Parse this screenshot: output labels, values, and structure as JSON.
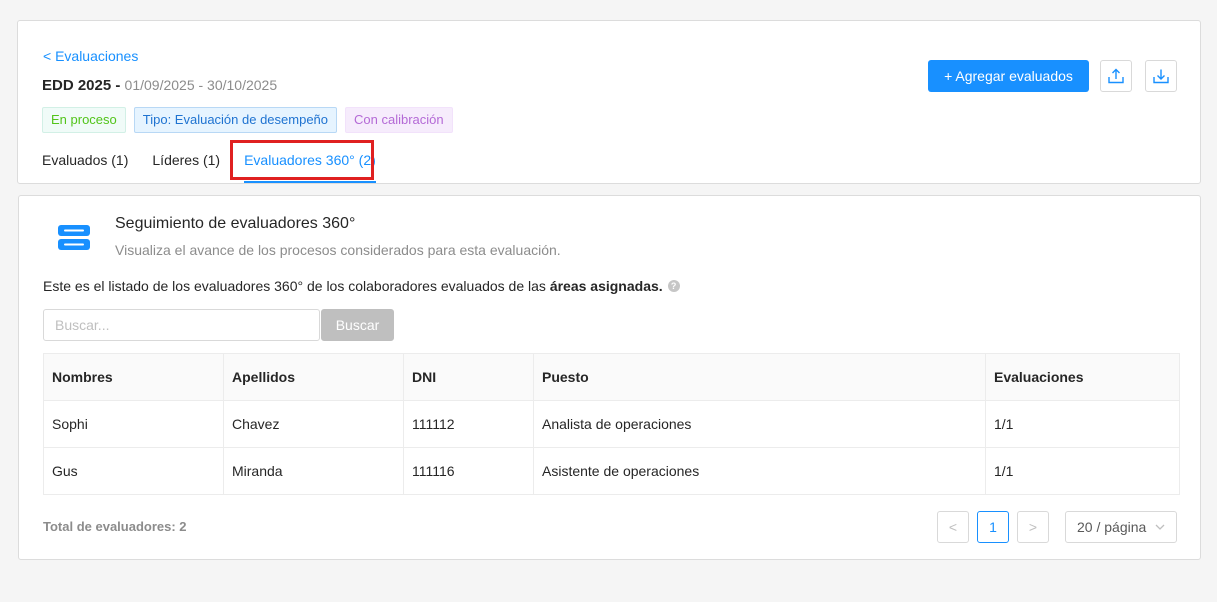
{
  "header": {
    "back_link": "< Evaluaciones",
    "title": "EDD 2025 -",
    "dates": "01/09/2025 - 30/10/2025",
    "tags": [
      "En proceso",
      "Tipo: Evaluación de desempeño",
      "Con calibración"
    ],
    "add_button": "+ Agregar evaluados",
    "upload_icon": "upload-icon",
    "download_icon": "download-icon",
    "tabs": [
      {
        "label": "Evaluados (1)"
      },
      {
        "label": "Líderes (1)"
      },
      {
        "label": "Evaluadores 360° (2)"
      }
    ]
  },
  "section": {
    "title": "Seguimiento de evaluadores 360°",
    "subtitle": "Visualiza el avance de los procesos considerados para esta evaluación.",
    "desc_prefix": "Este es el listado de los evaluadores 360° de los colaboradores evaluados de las",
    "desc_bold": "áreas asignadas.",
    "help_icon": "?"
  },
  "search": {
    "placeholder": "Buscar...",
    "button": "Buscar"
  },
  "table": {
    "columns": [
      "Nombres",
      "Apellidos",
      "DNI",
      "Puesto",
      "Evaluaciones"
    ],
    "rows": [
      [
        "Sophi",
        "Chavez",
        "111112",
        "Analista de operaciones",
        "1/1"
      ],
      [
        "Gus",
        "Miranda",
        "111116",
        "Asistente de operaciones",
        "1/1"
      ]
    ]
  },
  "footer": {
    "total": "Total de evaluadores: 2",
    "prev": "<",
    "current_page": "1",
    "next": ">",
    "page_size": "20 / página"
  },
  "colors": {
    "accent": "#1890ff",
    "highlight": "#e02020"
  }
}
